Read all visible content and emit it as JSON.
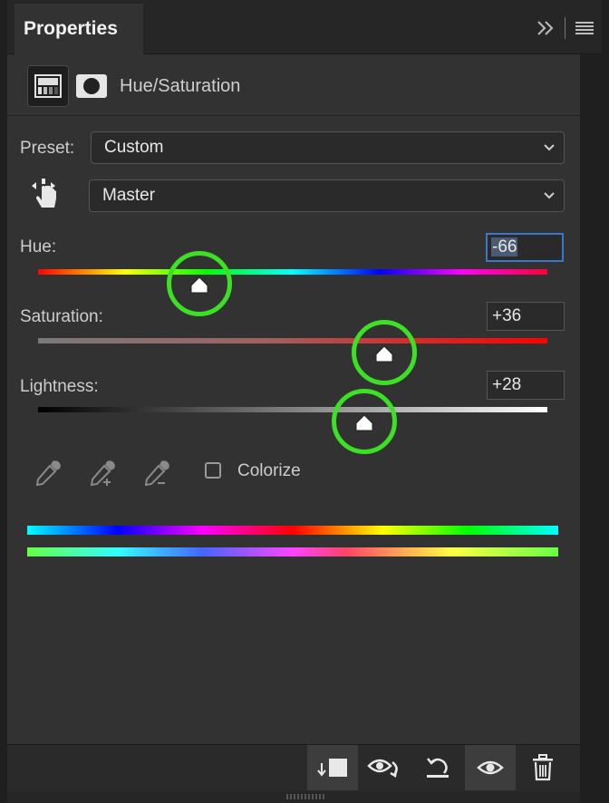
{
  "tab": {
    "title": "Properties"
  },
  "header": {
    "title": "Hue/Saturation"
  },
  "preset": {
    "label": "Preset:",
    "value": "Custom"
  },
  "channel": {
    "value": "Master"
  },
  "hue": {
    "label": "Hue:",
    "value": "-66",
    "level": -66,
    "min": -180,
    "max": 180
  },
  "saturation": {
    "label": "Saturation:",
    "value": "+36",
    "level": 36,
    "min": -100,
    "max": 100
  },
  "lightness": {
    "label": "Lightness:",
    "value": "+28",
    "level": 28,
    "min": -100,
    "max": 100
  },
  "colorize": {
    "label": "Colorize",
    "checked": false
  },
  "icons": {
    "expand": "double-chevron-right-icon",
    "menu": "hamburger-menu-icon",
    "adjustment": "hue-saturation-adjustment-icon",
    "mask": "layer-mask-icon",
    "targeted_adjust": "hand-scrubby-icon",
    "eyedropper": "eyedropper-icon",
    "eyedropper_plus": "eyedropper-add-icon",
    "eyedropper_minus": "eyedropper-subtract-icon",
    "clip": "clip-to-layer-icon",
    "view_previous": "view-previous-state-icon",
    "reset": "reset-icon",
    "visibility": "eye-icon",
    "delete": "trash-icon"
  },
  "colors": {
    "highlight_ring": "#3ce025",
    "panel_bg": "#323232",
    "active_field": "#3b77c8"
  }
}
